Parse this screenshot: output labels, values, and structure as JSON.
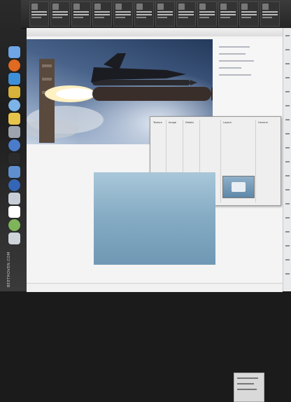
{
  "watermark": {
    "text": "BEETHOVEN.COM"
  },
  "dock": {
    "items": [
      {
        "name": "finder-icon",
        "color": "#6ea6e6"
      },
      {
        "name": "firefox-icon",
        "color": "#e06a22"
      },
      {
        "name": "safari-icon",
        "color": "#3f8fd8"
      },
      {
        "name": "chrome-icon",
        "color": "#d8b23a"
      },
      {
        "name": "itunes-icon",
        "color": "#7db4e8"
      },
      {
        "name": "photos-icon",
        "color": "#e6c34a"
      },
      {
        "name": "settings-icon",
        "color": "#9da4ad"
      },
      {
        "name": "globe-icon",
        "color": "#4a7cc9"
      },
      {
        "name": "terminal-icon",
        "color": "#2b2b2b"
      },
      {
        "name": "mail-icon",
        "color": "#5f8fcf"
      },
      {
        "name": "app-icon",
        "color": "#3566b5"
      },
      {
        "name": "app2-icon",
        "color": "#c7ced8"
      },
      {
        "name": "app3-icon",
        "color": "#ffffff"
      },
      {
        "name": "app4-icon",
        "color": "#7fb55a"
      },
      {
        "name": "trash-icon",
        "color": "#cfd4da"
      }
    ]
  },
  "taskbar": {
    "item_count": 12
  },
  "panel": {
    "columns": [
      {
        "label": "Texture"
      },
      {
        "label": "Image"
      },
      {
        "label": "Details"
      },
      {
        "label": "Layout"
      },
      {
        "label": "General"
      }
    ]
  },
  "colors": {
    "accent": "#e4761f",
    "sky": "#48628a"
  }
}
